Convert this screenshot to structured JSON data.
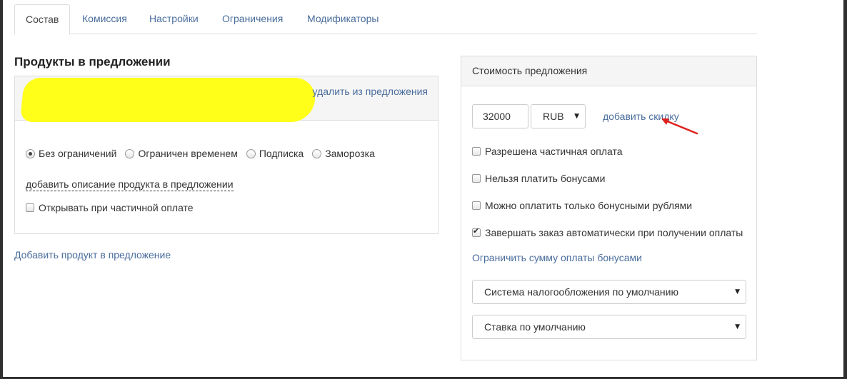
{
  "tabs": [
    {
      "label": "Состав",
      "active": true
    },
    {
      "label": "Комиссия",
      "active": false
    },
    {
      "label": "Настройки",
      "active": false
    },
    {
      "label": "Ограничения",
      "active": false
    },
    {
      "label": "Модификаторы",
      "active": false
    }
  ],
  "products": {
    "title": "Продукты в предложении",
    "remove_link": "удалить из предложения",
    "access_options": [
      {
        "label": "Без ограничений",
        "selected": true
      },
      {
        "label": "Ограничен временем",
        "selected": false
      },
      {
        "label": "Подписка",
        "selected": false
      },
      {
        "label": "Заморозка",
        "selected": false
      }
    ],
    "add_description_link": "добавить описание продукта в предложении",
    "open_partial_label": "Открывать при частичной оплате",
    "open_partial_checked": false,
    "add_product_link": "Добавить продукт в предложение"
  },
  "cost": {
    "title": "Стоимость предложения",
    "price_value": "32000",
    "currency": "RUB",
    "add_discount_link": "добавить скидку",
    "options": [
      {
        "label": "Разрешена частичная оплата",
        "checked": false
      },
      {
        "label": "Нельзя платить бонусами",
        "checked": false
      },
      {
        "label": "Можно оплатить только бонусными рублями",
        "checked": false
      },
      {
        "label": "Завершать заказ автоматически при получении оплаты",
        "checked": true
      }
    ],
    "limit_bonus_link": "Ограничить сумму оплаты бонусами",
    "tax_system": "Система налогообложения по умолчанию",
    "vat_rate": "Ставка по умолчанию"
  },
  "colors": {
    "link": "#4a6d9c",
    "highlight": "#ffff1a",
    "annotation_arrow": "#e0201c"
  }
}
